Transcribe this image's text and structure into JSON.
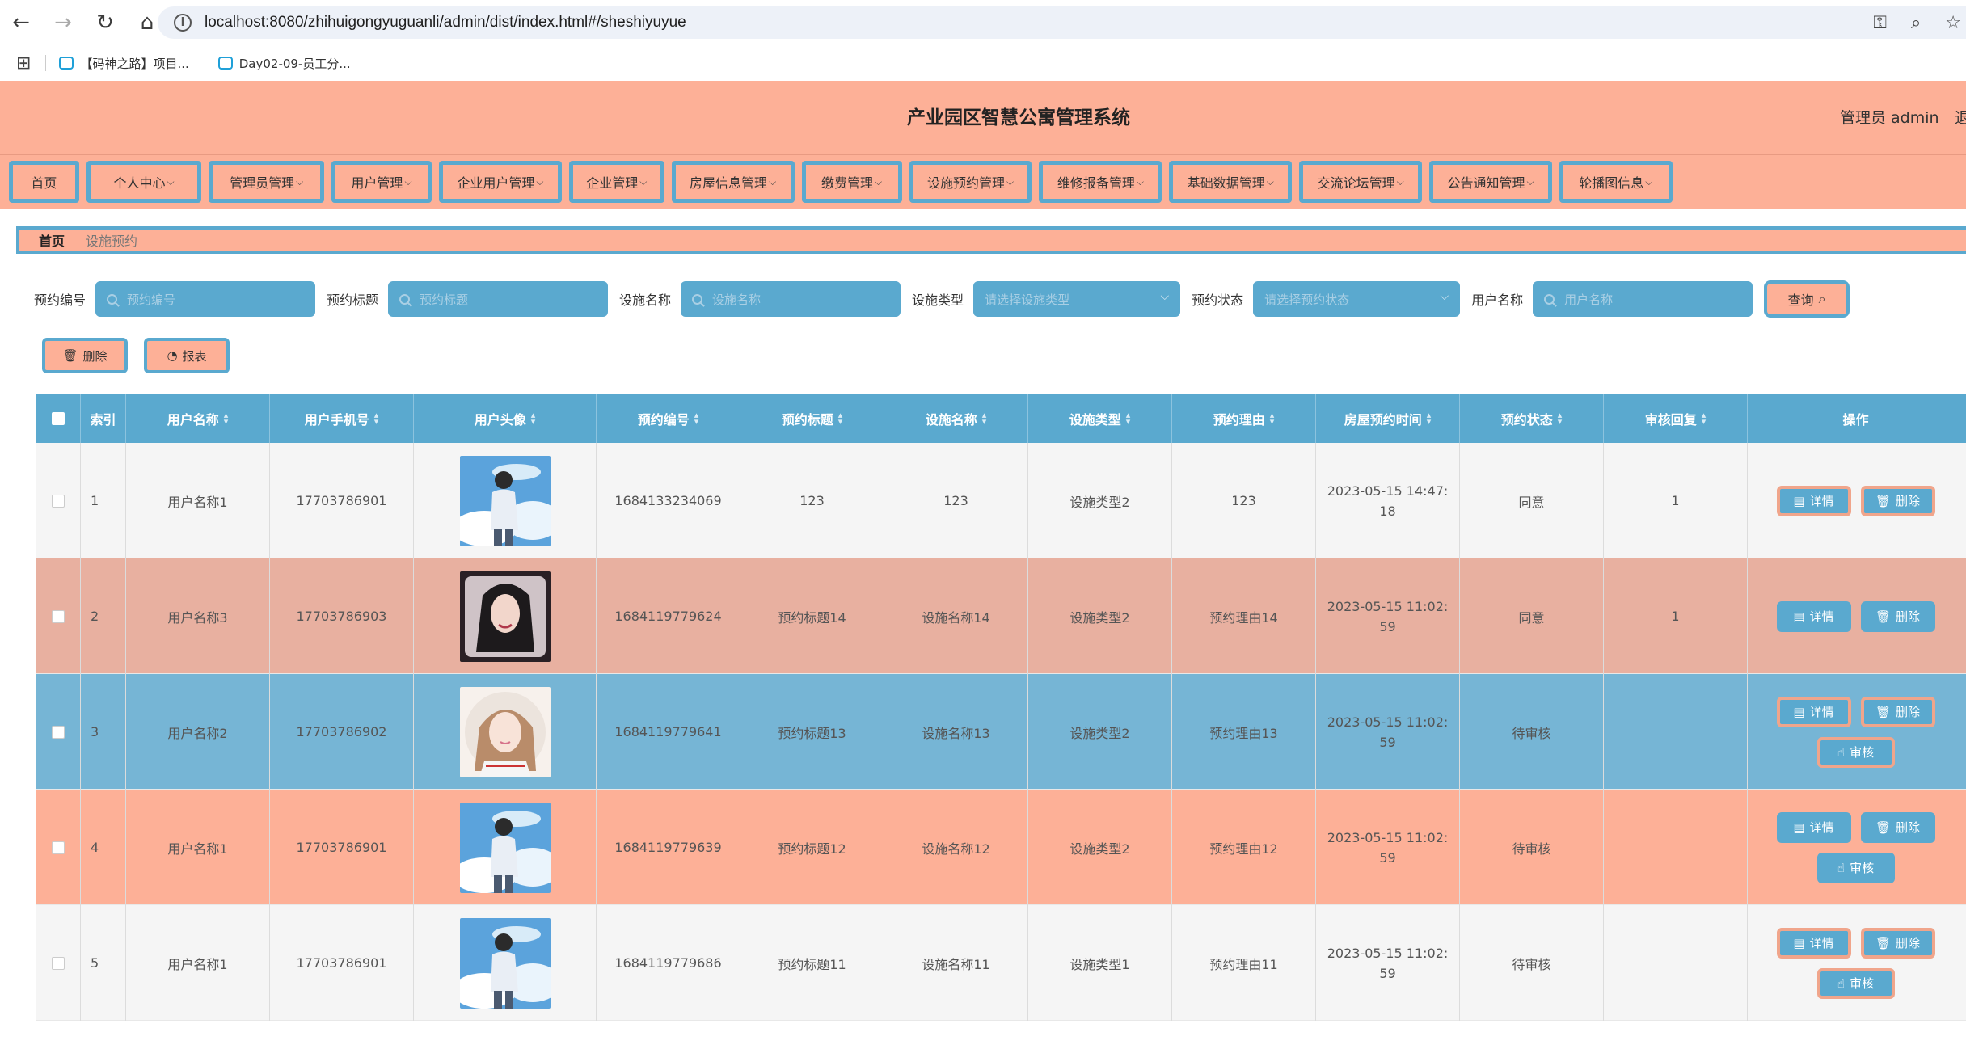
{
  "browser": {
    "url": "localhost:8080/zhihuigongyuguanli/admin/dist/index.html#/sheshiyuyue",
    "bookmarks": [
      "【码神之路】项目...",
      "Day02-09-员工分..."
    ]
  },
  "header": {
    "title": "产业园区智慧公寓管理系统",
    "admin_label": "管理员 admin",
    "logout_label": "退"
  },
  "menu": [
    {
      "label": "首页",
      "dropdown": false
    },
    {
      "label": "个人中心",
      "dropdown": true
    },
    {
      "label": "管理员管理",
      "dropdown": true
    },
    {
      "label": "用户管理",
      "dropdown": true
    },
    {
      "label": "企业用户管理",
      "dropdown": true
    },
    {
      "label": "企业管理",
      "dropdown": true
    },
    {
      "label": "房屋信息管理",
      "dropdown": true
    },
    {
      "label": "缴费管理",
      "dropdown": true
    },
    {
      "label": "设施预约管理",
      "dropdown": true
    },
    {
      "label": "维修报备管理",
      "dropdown": true
    },
    {
      "label": "基础数据管理",
      "dropdown": true
    },
    {
      "label": "交流论坛管理",
      "dropdown": true
    },
    {
      "label": "公告通知管理",
      "dropdown": true
    },
    {
      "label": "轮播图信息",
      "dropdown": true
    }
  ],
  "breadcrumb": {
    "home": "首页",
    "current": "设施预约"
  },
  "search": {
    "fields": [
      {
        "label": "预约编号",
        "placeholder": "预约编号",
        "type": "input"
      },
      {
        "label": "预约标题",
        "placeholder": "预约标题",
        "type": "input"
      },
      {
        "label": "设施名称",
        "placeholder": "设施名称",
        "type": "input"
      },
      {
        "label": "设施类型",
        "placeholder": "请选择设施类型",
        "type": "select"
      },
      {
        "label": "预约状态",
        "placeholder": "请选择预约状态",
        "type": "select"
      },
      {
        "label": "用户名称",
        "placeholder": "用户名称",
        "type": "input"
      }
    ],
    "query_label": "查询"
  },
  "actions": {
    "delete_label": "删除",
    "report_label": "报表"
  },
  "table": {
    "columns": [
      "索引",
      "用户名称",
      "用户手机号",
      "用户头像",
      "预约编号",
      "预约标题",
      "设施名称",
      "设施类型",
      "预约理由",
      "房屋预约时间",
      "预约状态",
      "审核回复",
      "操作"
    ],
    "detail_label": "详情",
    "delete_label": "删除",
    "review_label": "审核",
    "rows": [
      {
        "index": "1",
        "user": "用户名称1",
        "phone": "17703786901",
        "avatar": "boy",
        "no": "1684133234069",
        "title": "123",
        "facility": "123",
        "type": "设施类型2",
        "reason": "123",
        "time": "2023-05-15 14:47:18",
        "status": "同意",
        "reply": "1",
        "review": false
      },
      {
        "index": "2",
        "user": "用户名称3",
        "phone": "17703786903",
        "avatar": "woman",
        "no": "1684119779624",
        "title": "预约标题14",
        "facility": "设施名称14",
        "type": "设施类型2",
        "reason": "预约理由14",
        "time": "2023-05-15 11:02:59",
        "status": "同意",
        "reply": "1",
        "review": false
      },
      {
        "index": "3",
        "user": "用户名称2",
        "phone": "17703786902",
        "avatar": "girl",
        "no": "1684119779641",
        "title": "预约标题13",
        "facility": "设施名称13",
        "type": "设施类型2",
        "reason": "预约理由13",
        "time": "2023-05-15 11:02:59",
        "status": "待审核",
        "reply": "",
        "review": true
      },
      {
        "index": "4",
        "user": "用户名称1",
        "phone": "17703786901",
        "avatar": "boy",
        "no": "1684119779639",
        "title": "预约标题12",
        "facility": "设施名称12",
        "type": "设施类型2",
        "reason": "预约理由12",
        "time": "2023-05-15 11:02:59",
        "status": "待审核",
        "reply": "",
        "review": true
      },
      {
        "index": "5",
        "user": "用户名称1",
        "phone": "17703786901",
        "avatar": "boy",
        "no": "1684119779686",
        "title": "预约标题11",
        "facility": "设施名称11",
        "type": "设施类型1",
        "reason": "预约理由11",
        "time": "2023-05-15 11:02:59",
        "status": "待审核",
        "reply": "",
        "review": true
      }
    ]
  },
  "colors": {
    "accent_peach": "#fdb097",
    "accent_blue": "#5aa9cf",
    "row_salmon": "#e8b0a0",
    "row_blue": "#76b5d5"
  }
}
